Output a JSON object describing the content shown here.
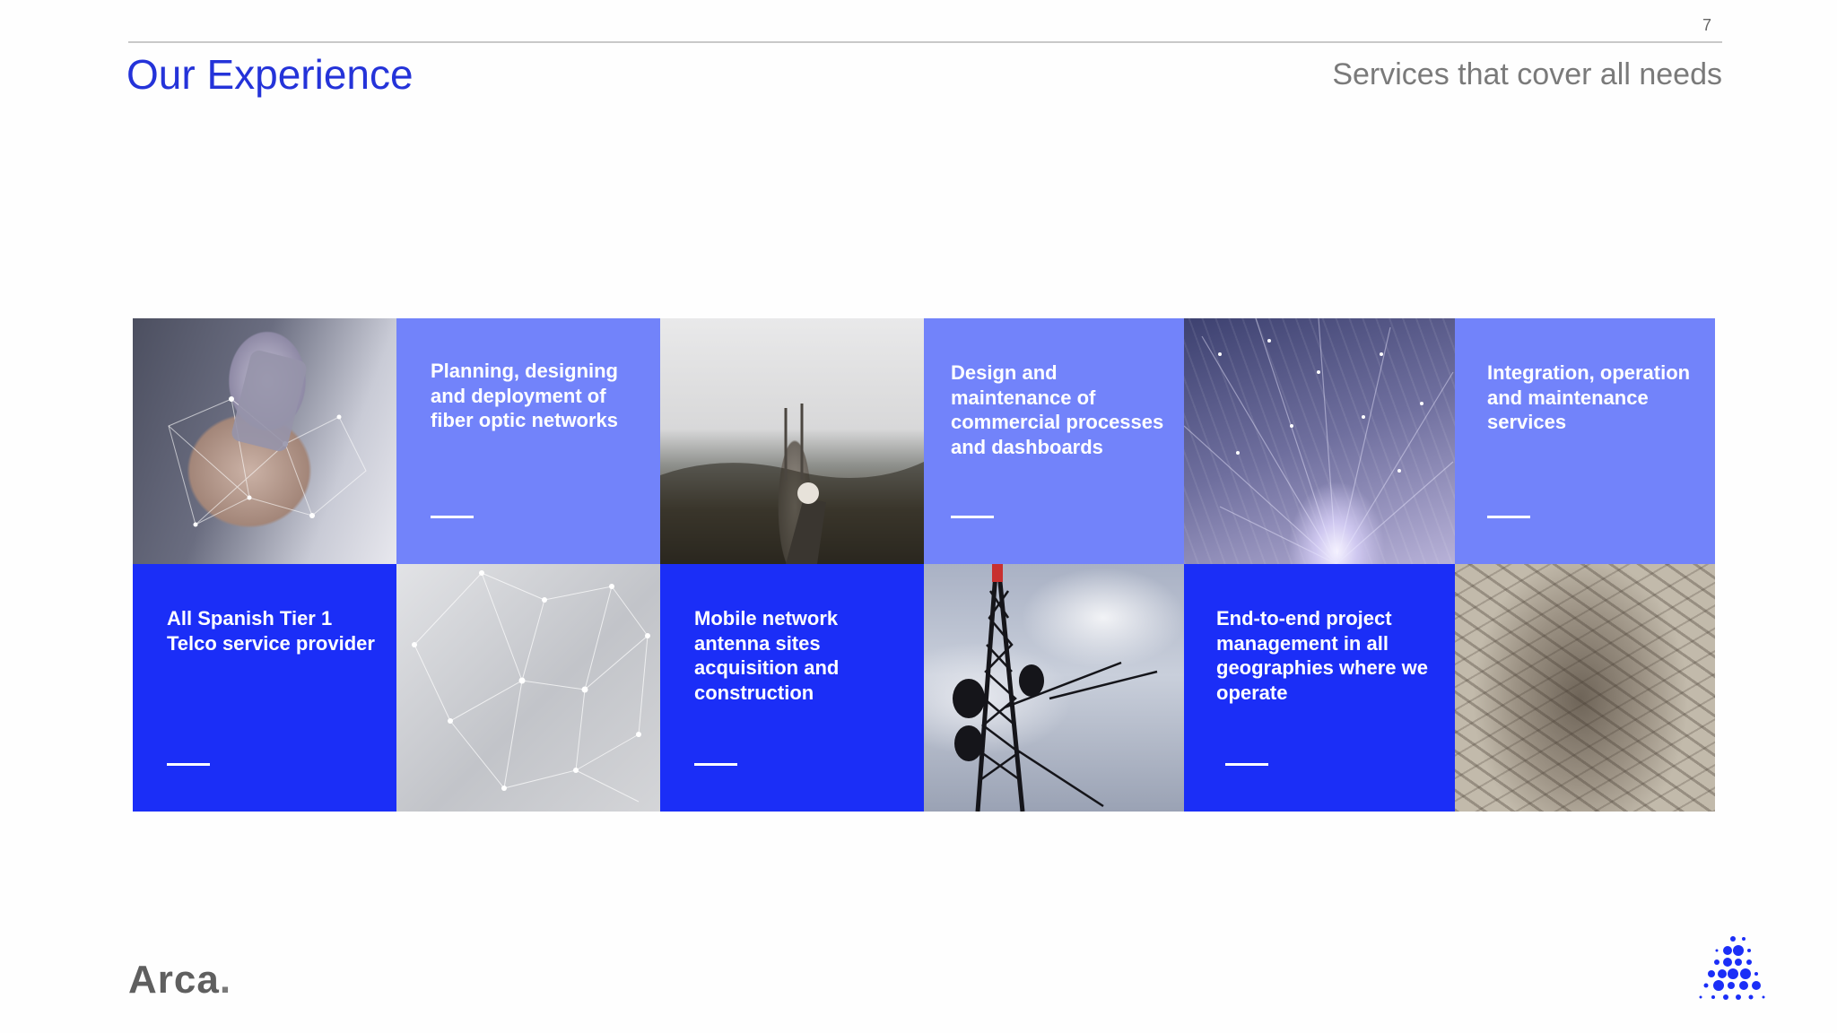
{
  "header": {
    "page_number": "7",
    "title": "Our Experience",
    "subtitle": "Services that cover all needs"
  },
  "tiles": {
    "fiber": "Planning, designing and deployment of fiber optic networks",
    "commercial": "Design and maintenance of commercial processes and dashboards",
    "integration": "Integration, operation and maintenance services",
    "telco": "All Spanish Tier 1 Telco service provider",
    "antenna": "Mobile network antenna sites acquisition and construction",
    "project": "End-to-end project management in all geographies where we operate"
  },
  "footer": {
    "logo_text": "Arca",
    "logo_dot": "."
  },
  "colors": {
    "title_blue": "#2433d9",
    "tile_lavender": "#7283fa",
    "tile_blue": "#1b2ef7"
  },
  "icons": {
    "brand_mark": "dot-grid-logo-icon"
  }
}
